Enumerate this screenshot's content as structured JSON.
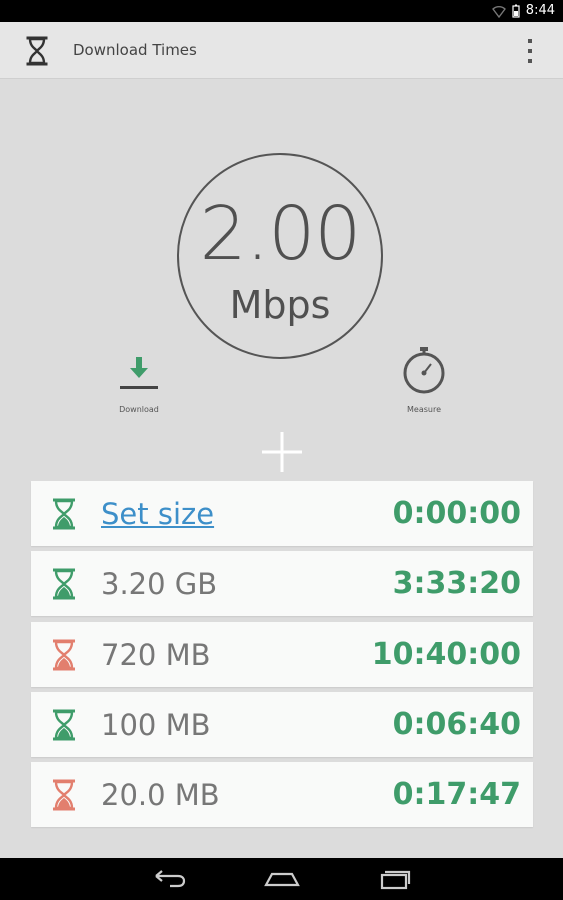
{
  "status_bar": {
    "time": "8:44"
  },
  "action_bar": {
    "title": "Download Times",
    "app_icon": "hourglass-icon",
    "menu_icon": "overflow-menu-icon"
  },
  "speed": {
    "value": "2.00",
    "unit": "Mbps"
  },
  "tools": [
    {
      "label": "Download",
      "icon": "download-icon"
    },
    {
      "label": "Measure",
      "icon": "stopwatch-icon"
    }
  ],
  "add_icon": "plus-icon",
  "rows": [
    {
      "size": "Set size",
      "time": "0:00:00",
      "icon_color": "#3f9c6a"
    },
    {
      "size": "3.20 GB",
      "time": "3:33:20",
      "icon_color": "#3f9c6a"
    },
    {
      "size": "720 MB",
      "time": "10:40:00",
      "icon_color": "#e27f6e"
    },
    {
      "size": "100 MB",
      "time": "0:06:40",
      "icon_color": "#3f9c6a"
    },
    {
      "size": "20.0 MB",
      "time": "0:17:47",
      "icon_color": "#e27f6e"
    }
  ],
  "colors": {
    "accent_green": "#3f9c6a",
    "link_blue": "#3d8fc9",
    "warn_red": "#e27f6e"
  },
  "nav": {
    "back_icon": "back-icon",
    "home_icon": "home-icon",
    "recents_icon": "recents-icon"
  }
}
